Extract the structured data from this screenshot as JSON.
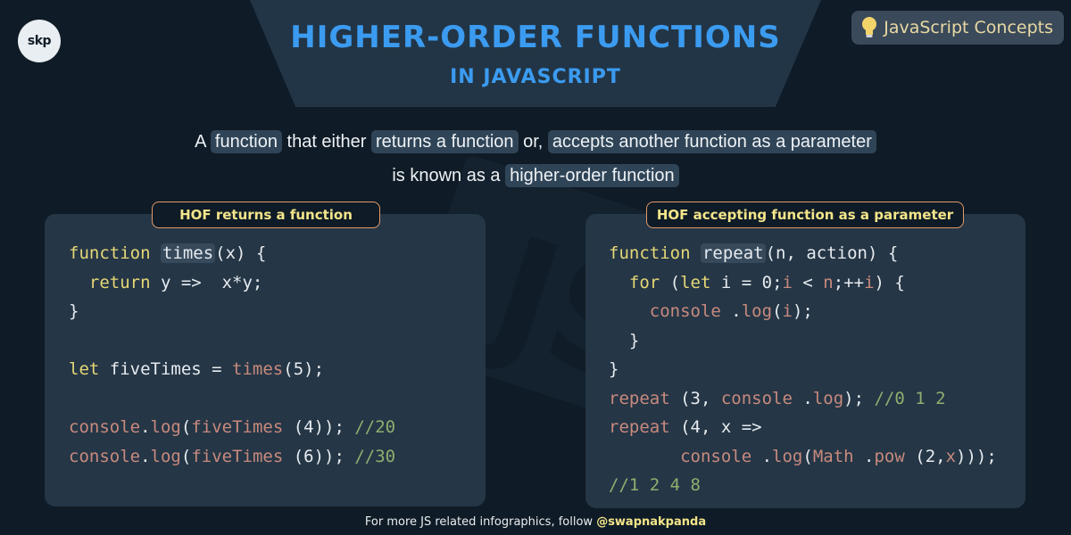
{
  "header": {
    "title": "HIGHER-ORDER FUNCTIONS",
    "subtitle": "IN JAVASCRIPT",
    "logo_text": "skp",
    "tag_label": "JavaScript Concepts",
    "tag_icon": "lightbulb-icon"
  },
  "definition": {
    "part1": "A ",
    "hl1": "function",
    "part2": " that either ",
    "hl2": "returns a function",
    "part3": " or, ",
    "hl3": "accepts another function as a parameter",
    "part4": "is known as a ",
    "hl4": "higher-order function"
  },
  "left_panel": {
    "label": "HOF returns a function",
    "code": {
      "l1_kw": "function",
      "l1_name": "times",
      "l1_rest": "(x) {",
      "l2_kw": "return",
      "l2_rest": " y =>  x*y;",
      "l3": "}",
      "l5_kw": "let",
      "l5_mid": " fiveTimes = ",
      "l5_call": "times",
      "l5_rest": "(5);",
      "l7_obj": "console",
      "l7_dot": ".",
      "l7_fn": "log",
      "l7_paren": "(",
      "l7_inner": "fiveTimes",
      "l7_arg": " (4)); ",
      "l7_comment": "//20",
      "l8_obj": "console",
      "l8_dot": ".",
      "l8_fn": "log",
      "l8_paren": "(",
      "l8_inner": "fiveTimes",
      "l8_arg": " (6)); ",
      "l8_comment": "//30"
    }
  },
  "right_panel": {
    "label": "HOF accepting function as a parameter",
    "code": {
      "l1_kw": "function",
      "l1_name": "repeat",
      "l1_rest": "(n, action) {",
      "l2_kw": "for",
      "l2_rest": " (",
      "l2_let": "let",
      "l2_rest2": " i = 0;",
      "l2_i": "i",
      "l2_rest3": " < ",
      "l2_n": "n",
      "l2_rest4": ";++",
      "l2_i2": "i",
      "l2_rest5": ") {",
      "l3_obj": "console",
      "l3_dot": " .",
      "l3_fn": "log",
      "l3_rest": "(",
      "l3_i": "i",
      "l3_end": ");",
      "l4": "}",
      "l5": "}",
      "l6_call": "repeat",
      "l6_rest": " (3, ",
      "l6_obj": "console",
      "l6_dot": " .",
      "l6_fn": "log",
      "l6_end": "); ",
      "l6_comment": "//0 1 2",
      "l7_call": "repeat",
      "l7_rest": " (4, x =>",
      "l8_obj": "console",
      "l8_dot": " .",
      "l8_fn": "log",
      "l8_p": "(",
      "l8_math": "Math",
      "l8_dot2": " .",
      "l8_pow": "pow",
      "l8_args": " (2,",
      "l8_x": "x",
      "l8_end": ")));",
      "l9_comment": "//1 2 4 8"
    }
  },
  "footer": {
    "text": "For more JS related infographics, follow ",
    "handle": "@swapnakpanda"
  },
  "watermark": {
    "letters": "JS"
  }
}
